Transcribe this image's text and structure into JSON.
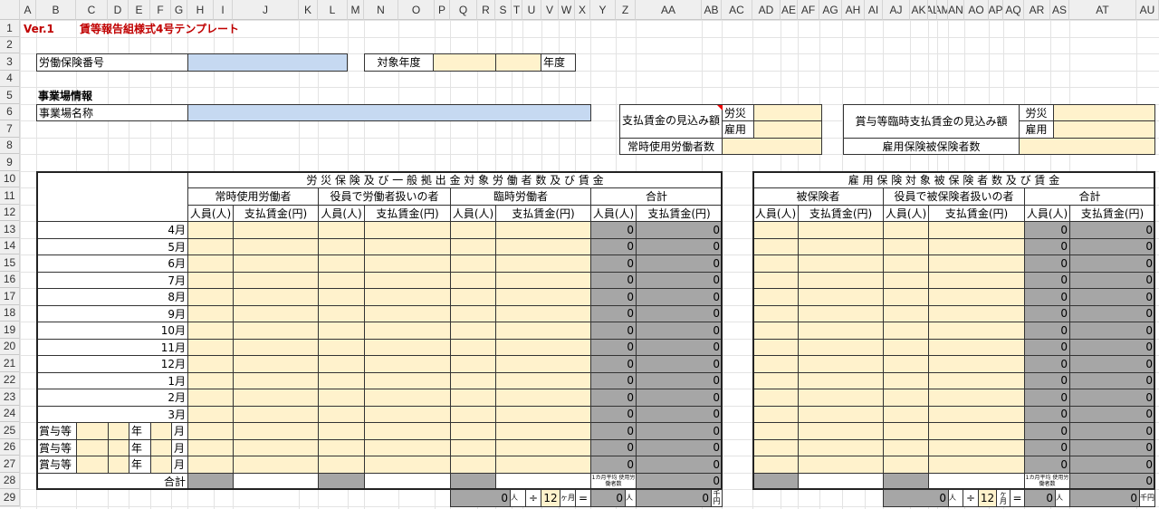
{
  "columns": [
    "A",
    "B",
    "C",
    "D",
    "E",
    "F",
    "G",
    "H",
    "I",
    "J",
    "K",
    "L",
    "M",
    "N",
    "O",
    "P",
    "Q",
    "R",
    "S",
    "T",
    "U",
    "V",
    "W",
    "X",
    "Y",
    "Z",
    "AA",
    "AB",
    "AC",
    "AD",
    "AE",
    "AF",
    "AG",
    "AH",
    "AI",
    "AJ",
    "AK",
    "AL",
    "AM",
    "AN",
    "AO",
    "AP",
    "AQ",
    "AR",
    "AS",
    "AT",
    "AU"
  ],
  "rows": [
    "1",
    "2",
    "3",
    "4",
    "5",
    "6",
    "7",
    "8",
    "9",
    "10",
    "11",
    "12",
    "13",
    "14",
    "15",
    "16",
    "17",
    "18",
    "19",
    "20",
    "21",
    "22",
    "23",
    "24",
    "25",
    "26",
    "27",
    "28",
    "29"
  ],
  "version": "Ver.1",
  "title": "賃等報告組様式4号テンプレート",
  "labor_insurance_number": {
    "label": "労働保険番号",
    "value": ""
  },
  "target_year": {
    "label": "対象年度",
    "era": "",
    "year": "",
    "suffix": "年度"
  },
  "section_title": "事業場情報",
  "business_name": {
    "label": "事業場名称",
    "value": ""
  },
  "wage_estimate": {
    "label": "支払賃金の見込み額",
    "rousai_label": "労災",
    "koyou_label": "雇用",
    "rousai": "",
    "koyou": "",
    "workers_label": "常時使用労働者数",
    "workers": ""
  },
  "bonus_estimate": {
    "label": "賞与等臨時支払賃金の見込み額",
    "rousai_label": "労災",
    "koyou_label": "雇用",
    "rousai": "",
    "koyou": "",
    "insured_label": "雇用保険被保険者数",
    "insured": ""
  },
  "colors": {
    "input": "#fff2cc",
    "computed": "#a6a6a6",
    "blue_input": "#c6d9f1",
    "title": "#c00000"
  },
  "months": [
    "4月",
    "5月",
    "6月",
    "7月",
    "8月",
    "9月",
    "10月",
    "11月",
    "12月",
    "1月",
    "2月",
    "3月"
  ],
  "bonus_rows": [
    {
      "label": "賞与等",
      "year_unit": "年",
      "month_unit": "月"
    },
    {
      "label": "賞与等",
      "year_unit": "年",
      "month_unit": "月"
    },
    {
      "label": "賞与等",
      "year_unit": "年",
      "month_unit": "月"
    }
  ],
  "sub_headers": {
    "people": "人員(人)",
    "wages": "支払賃金(円)"
  },
  "total_label": "合計",
  "left_table": {
    "title": "労 災 保 険 及 び 一 般 拠 出 金 対 象 労 働 者 数 及 び 賃 金",
    "groups": [
      "常時使用労働者",
      "役員で労働者扱いの者",
      "臨時労働者",
      "合計"
    ],
    "total_people": [
      "0",
      "0",
      "0",
      "0",
      "0",
      "0",
      "0",
      "0",
      "0",
      "0",
      "0",
      "0",
      "0",
      "0",
      "0"
    ],
    "total_wages": [
      "0",
      "0",
      "0",
      "0",
      "0",
      "0",
      "0",
      "0",
      "0",
      "0",
      "0",
      "0",
      "0",
      "0",
      "0"
    ],
    "avg_label": "1カ月平均 使用労働者数",
    "grand_total_wages": "0",
    "calc": {
      "people": "0",
      "person_unit": "人",
      "divide": "÷",
      "months": "12",
      "months_unit": "ヶ月",
      "equals": "=",
      "average": "0",
      "avg_unit": "人",
      "wages_thousand": "0",
      "thousand_yen": "千円"
    }
  },
  "right_table": {
    "title": "雇 用 保 険 対 象 被 保 険 者 数 及 び 賃 金",
    "groups": [
      "被保険者",
      "役員で被保険者扱いの者",
      "合計"
    ],
    "total_people": [
      "0",
      "0",
      "0",
      "0",
      "0",
      "0",
      "0",
      "0",
      "0",
      "0",
      "0",
      "0",
      "0",
      "0",
      "0"
    ],
    "total_wages": [
      "0",
      "0",
      "0",
      "0",
      "0",
      "0",
      "0",
      "0",
      "0",
      "0",
      "0",
      "0",
      "0",
      "0",
      "0"
    ],
    "avg_label": "1カ月平均 使用労働者数",
    "grand_total_wages": "0",
    "calc": {
      "people": "0",
      "person_unit": "人",
      "divide": "÷",
      "months": "12",
      "months_unit": "ヶ月",
      "equals": "=",
      "average": "0",
      "avg_unit": "人",
      "wages_thousand": "0",
      "thousand_yen": "千円"
    }
  }
}
